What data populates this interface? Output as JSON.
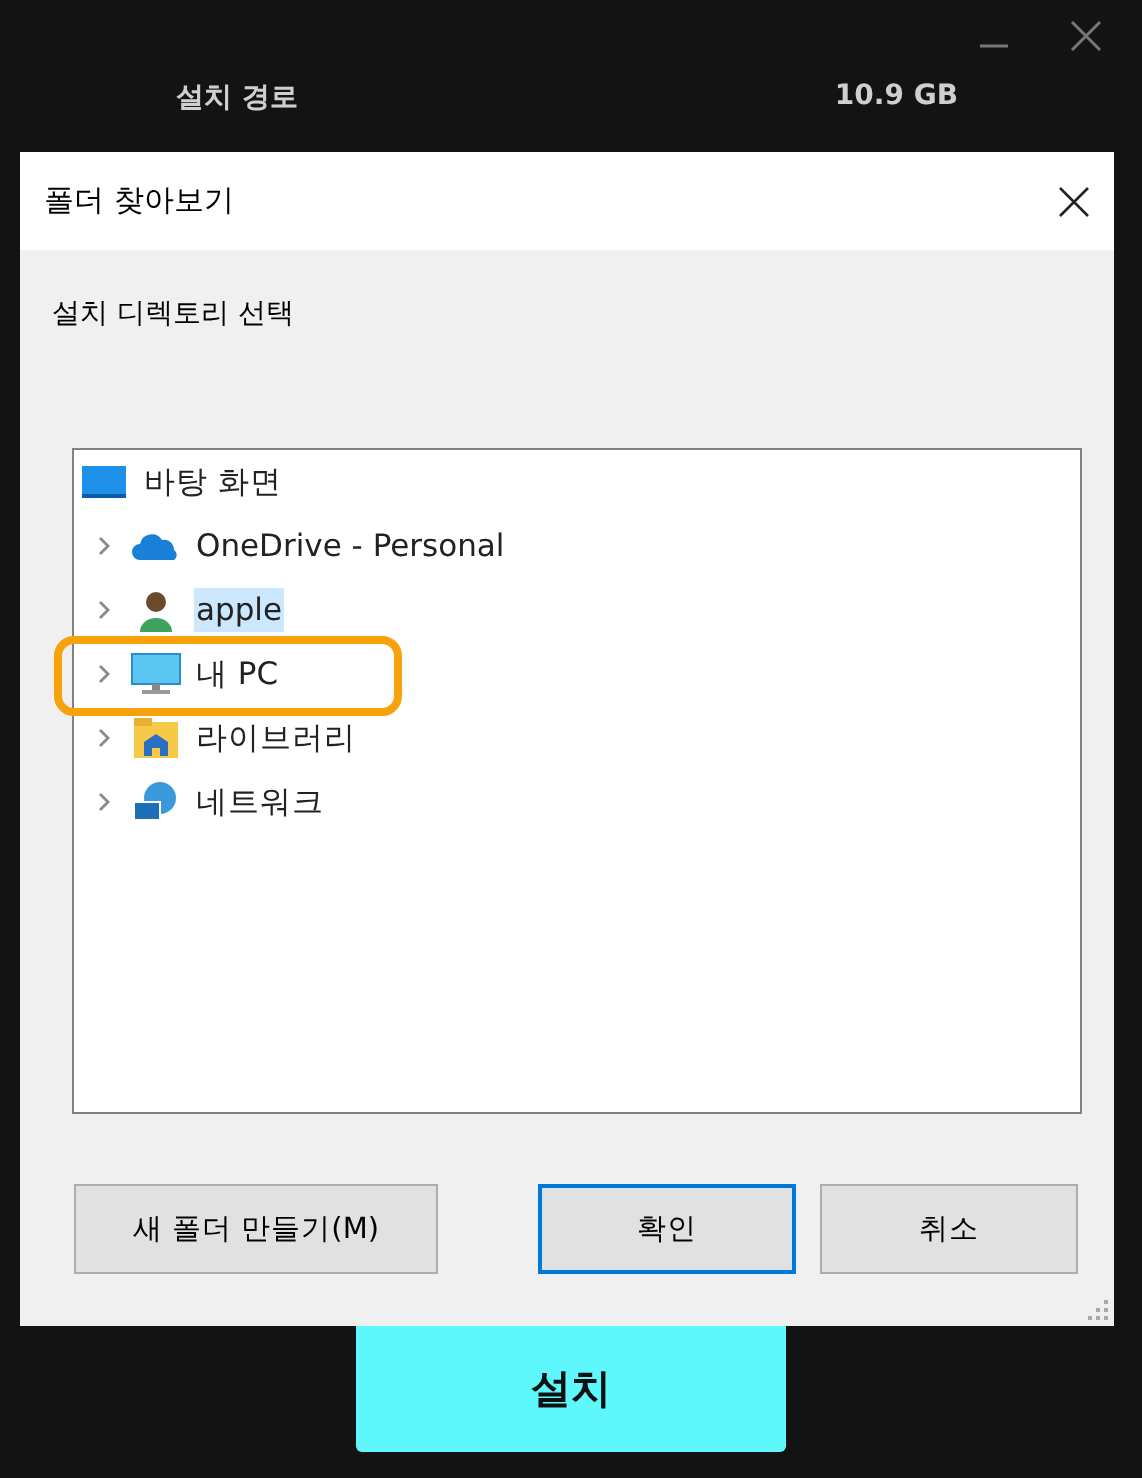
{
  "background": {
    "path_label": "설치 경로",
    "size": "10.9 GB",
    "install_button": "설치"
  },
  "dialog": {
    "title": "폴더 찾아보기",
    "prompt": "설치 디렉토리 선택",
    "tree": [
      {
        "label": "바탕 화면",
        "kind": "desktop",
        "selected": false,
        "highlighted": false,
        "children": [
          {
            "label": "OneDrive - Personal",
            "kind": "cloud",
            "selected": false,
            "highlighted": false
          },
          {
            "label": "apple",
            "kind": "user",
            "selected": true,
            "highlighted": false
          },
          {
            "label": "내 PC",
            "kind": "pc",
            "selected": false,
            "highlighted": true
          },
          {
            "label": "라이브러리",
            "kind": "library",
            "selected": false,
            "highlighted": false
          },
          {
            "label": "네트워크",
            "kind": "network",
            "selected": false,
            "highlighted": false
          }
        ]
      }
    ],
    "buttons": [
      {
        "label": "새 폴더 만들기(M)",
        "kind": "normal"
      },
      {
        "label": "확인",
        "kind": "default"
      },
      {
        "label": "취소",
        "kind": "normal"
      }
    ]
  }
}
